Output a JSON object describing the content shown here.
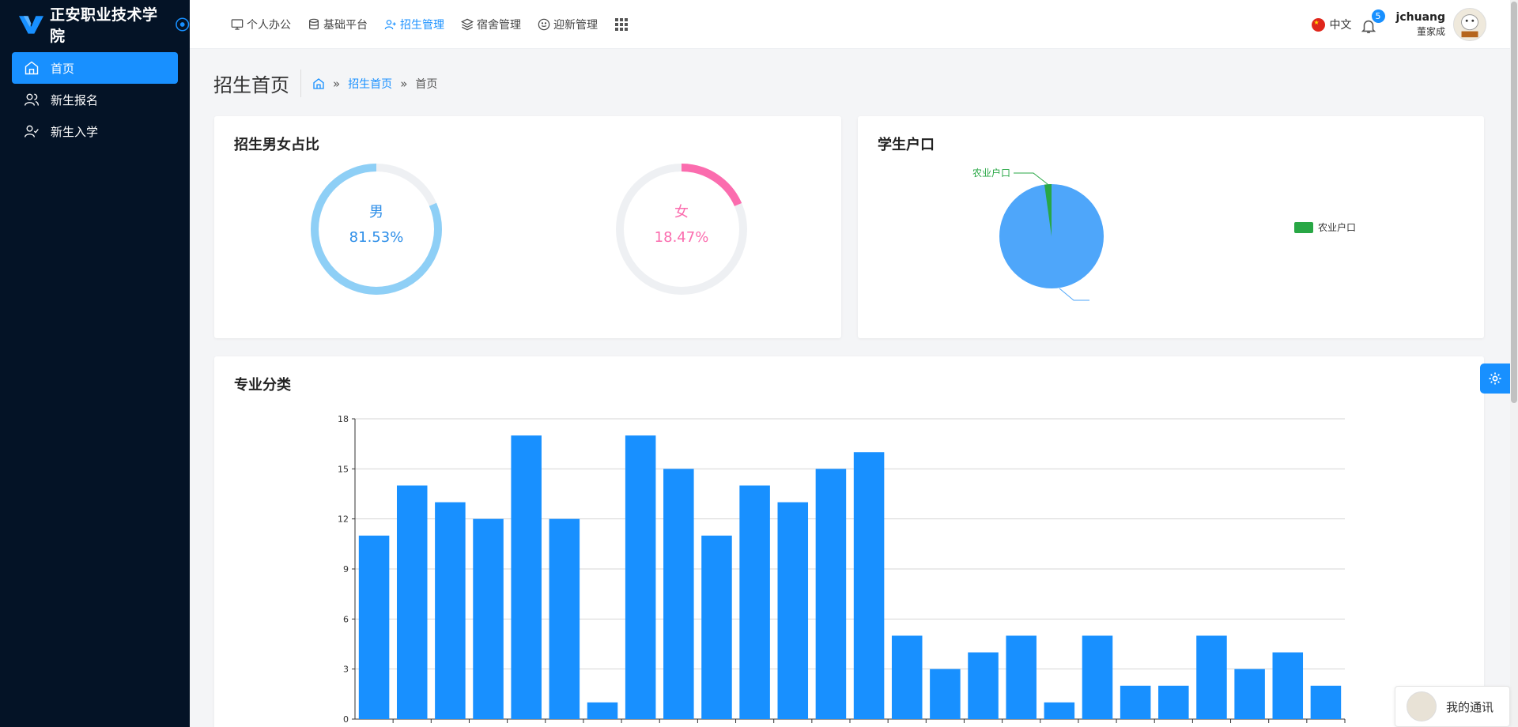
{
  "brand": {
    "title": "正安职业技术学院"
  },
  "sidebar": {
    "items": [
      {
        "label": "首页",
        "icon": "home-icon",
        "active": true
      },
      {
        "label": "新生报名",
        "icon": "users-icon",
        "active": false
      },
      {
        "label": "新生入学",
        "icon": "user-check-icon",
        "active": false
      }
    ]
  },
  "topnav": {
    "items": [
      {
        "label": "个人办公",
        "icon": "monitor-icon"
      },
      {
        "label": "基础平台",
        "icon": "database-icon"
      },
      {
        "label": "招生管理",
        "icon": "user-plus-icon",
        "active": true
      },
      {
        "label": "宿舍管理",
        "icon": "layers-icon"
      },
      {
        "label": "迎新管理",
        "icon": "smile-icon"
      }
    ],
    "language": "中文",
    "notification_count": "5",
    "username": "jchuang",
    "realname": "董家成"
  },
  "page": {
    "title": "招生首页",
    "breadcrumb": {
      "section": "招生首页",
      "current": "首页",
      "separator": "»"
    }
  },
  "gender_card": {
    "title": "招生男女占比",
    "male": {
      "label": "男",
      "value": "81.53%",
      "fraction": 0.8153,
      "color": "#8ecff6"
    },
    "female": {
      "label": "女",
      "value": "18.47%",
      "fraction": 0.1847,
      "color": "#fb6cae"
    }
  },
  "hukou_card": {
    "title": "学生户口",
    "slice_label": "农业户口",
    "legend_label": "农业户口",
    "colors": {
      "agri": "#28a745",
      "other": "#4ea6fa"
    }
  },
  "major_card": {
    "title": "专业分类"
  },
  "chart_data": {
    "type": "bar",
    "title": "",
    "values": [
      11,
      14,
      13,
      12,
      17,
      12,
      1,
      17,
      15,
      11,
      14,
      13,
      15,
      16,
      5,
      3,
      4,
      5,
      1,
      5,
      2,
      2,
      5,
      3,
      4,
      2
    ],
    "ylim": [
      0,
      18
    ],
    "yticks": [
      0,
      3,
      6,
      9,
      12,
      15,
      18
    ],
    "color": "#1890ff",
    "grid": true
  },
  "chat": {
    "label": "我的通讯"
  },
  "colors": {
    "accent": "#1890ff",
    "sidebar": "#041326"
  }
}
